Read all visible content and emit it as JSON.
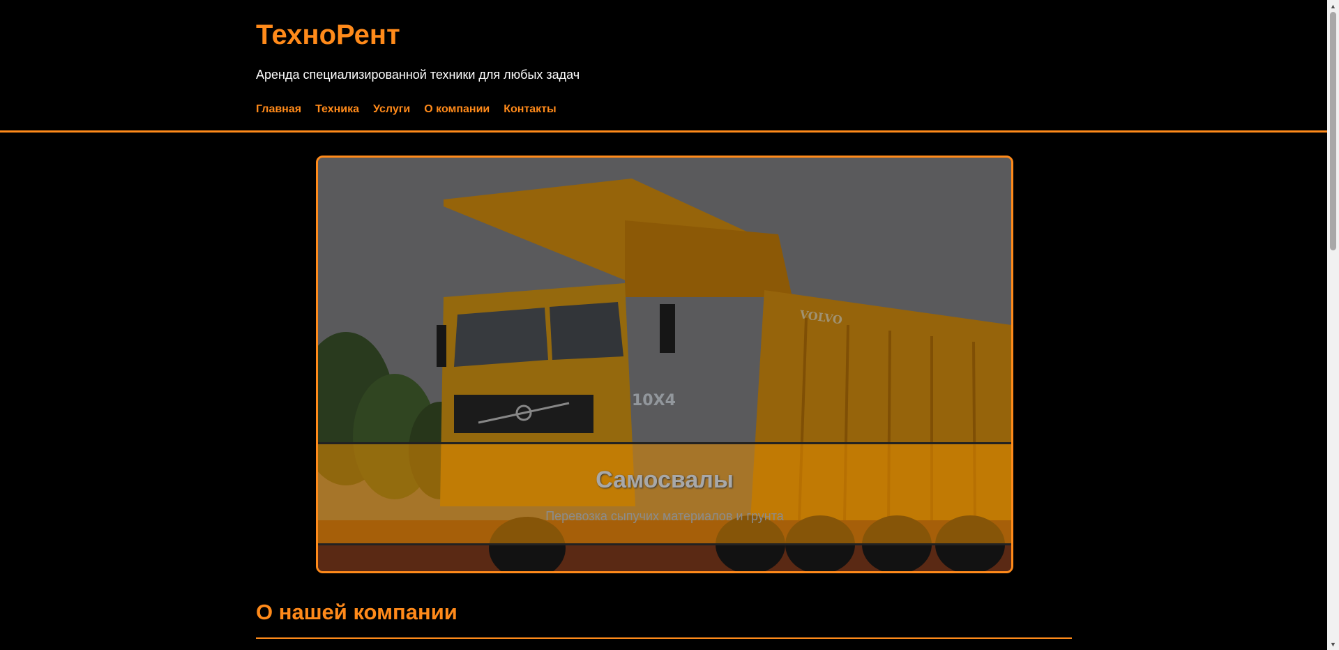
{
  "site": {
    "title": "ТехноРент",
    "tagline": "Аренда специализированной техники для любых задач"
  },
  "nav": {
    "items": [
      {
        "label": "Главная"
      },
      {
        "label": "Техника"
      },
      {
        "label": "Услуги"
      },
      {
        "label": "О компании"
      },
      {
        "label": "Контакты"
      }
    ]
  },
  "hero": {
    "title": "Самосвалы",
    "subtitle": "Перевозка сыпучих материалов и грунта",
    "truck_brand": "VOLVO",
    "truck_badge": "10X4",
    "image_icon": "dump-truck-photo"
  },
  "about": {
    "title": "О нашей компании"
  },
  "colors": {
    "accent": "#ff8a1a",
    "background": "#000000",
    "text": "#ffffff"
  }
}
